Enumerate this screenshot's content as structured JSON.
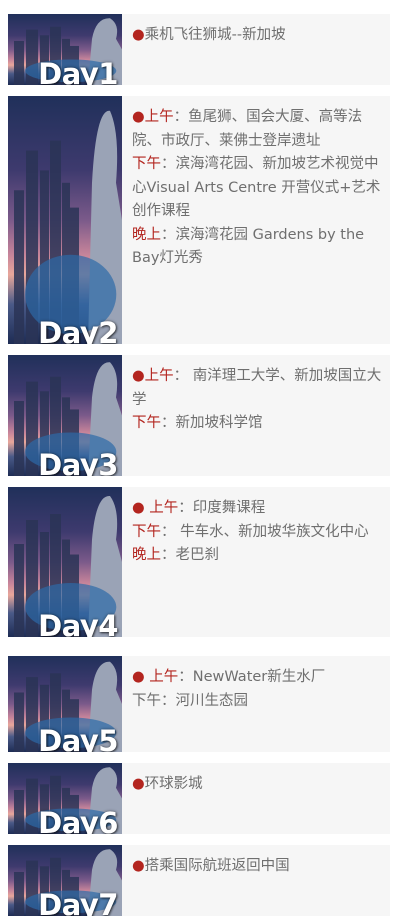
{
  "colors": {
    "accent": "#b3251f",
    "text": "#6f6f6f",
    "panel": "#f6f6f6"
  },
  "itinerary": [
    {
      "day_label": "Day1",
      "lines": [
        {
          "bullet": "●",
          "label": "",
          "text": "乘机飞往狮城--新加坡"
        }
      ]
    },
    {
      "day_label": "Day2",
      "lines": [
        {
          "bullet": "●",
          "label": "上午",
          "sep": "：",
          "text": "鱼尾狮、国会大厦、高等法院、市政厅、莱佛士登岸遗址"
        },
        {
          "bullet": "",
          "label": "下午",
          "sep": "：",
          "text": "滨海湾花园、新加坡艺术视觉中心Visual Arts Centre 开营仪式+艺术创作课程"
        },
        {
          "bullet": "",
          "label": "晚上",
          "sep": "：",
          "text": "滨海湾花园 Gardens by the Bay灯光秀"
        }
      ]
    },
    {
      "day_label": "Day3",
      "lines": [
        {
          "bullet": "●",
          "label": "上午",
          "sep": "：",
          "text": " 南洋理工大学、新加坡国立大学"
        },
        {
          "bullet": "",
          "label": "下午",
          "sep": "：",
          "text": "新加坡科学馆"
        }
      ]
    },
    {
      "day_label": "Day4",
      "lines": [
        {
          "bullet": "●",
          "label": " 上午",
          "sep": "：",
          "text": "印度舞课程"
        },
        {
          "bullet": "",
          "label": "下午",
          "sep": "：",
          "text": " 牛车水、新加坡华族文化中心"
        },
        {
          "bullet": "",
          "label": "晚上",
          "sep": "：",
          "text": "老巴刹"
        }
      ]
    },
    {
      "day_label": "Day5",
      "lines": [
        {
          "bullet": "●",
          "label": " 上午",
          "sep": "：",
          "text": "NewWater新生水厂"
        },
        {
          "bullet": "",
          "label": "",
          "text": "下午：河川生态园"
        }
      ]
    },
    {
      "day_label": "Day6",
      "lines": [
        {
          "bullet": "●",
          "label": "",
          "text": "环球影城"
        }
      ]
    },
    {
      "day_label": "Day7",
      "lines": [
        {
          "bullet": "●",
          "label": "",
          "text": "搭乘国际航班返回中国"
        }
      ]
    }
  ]
}
